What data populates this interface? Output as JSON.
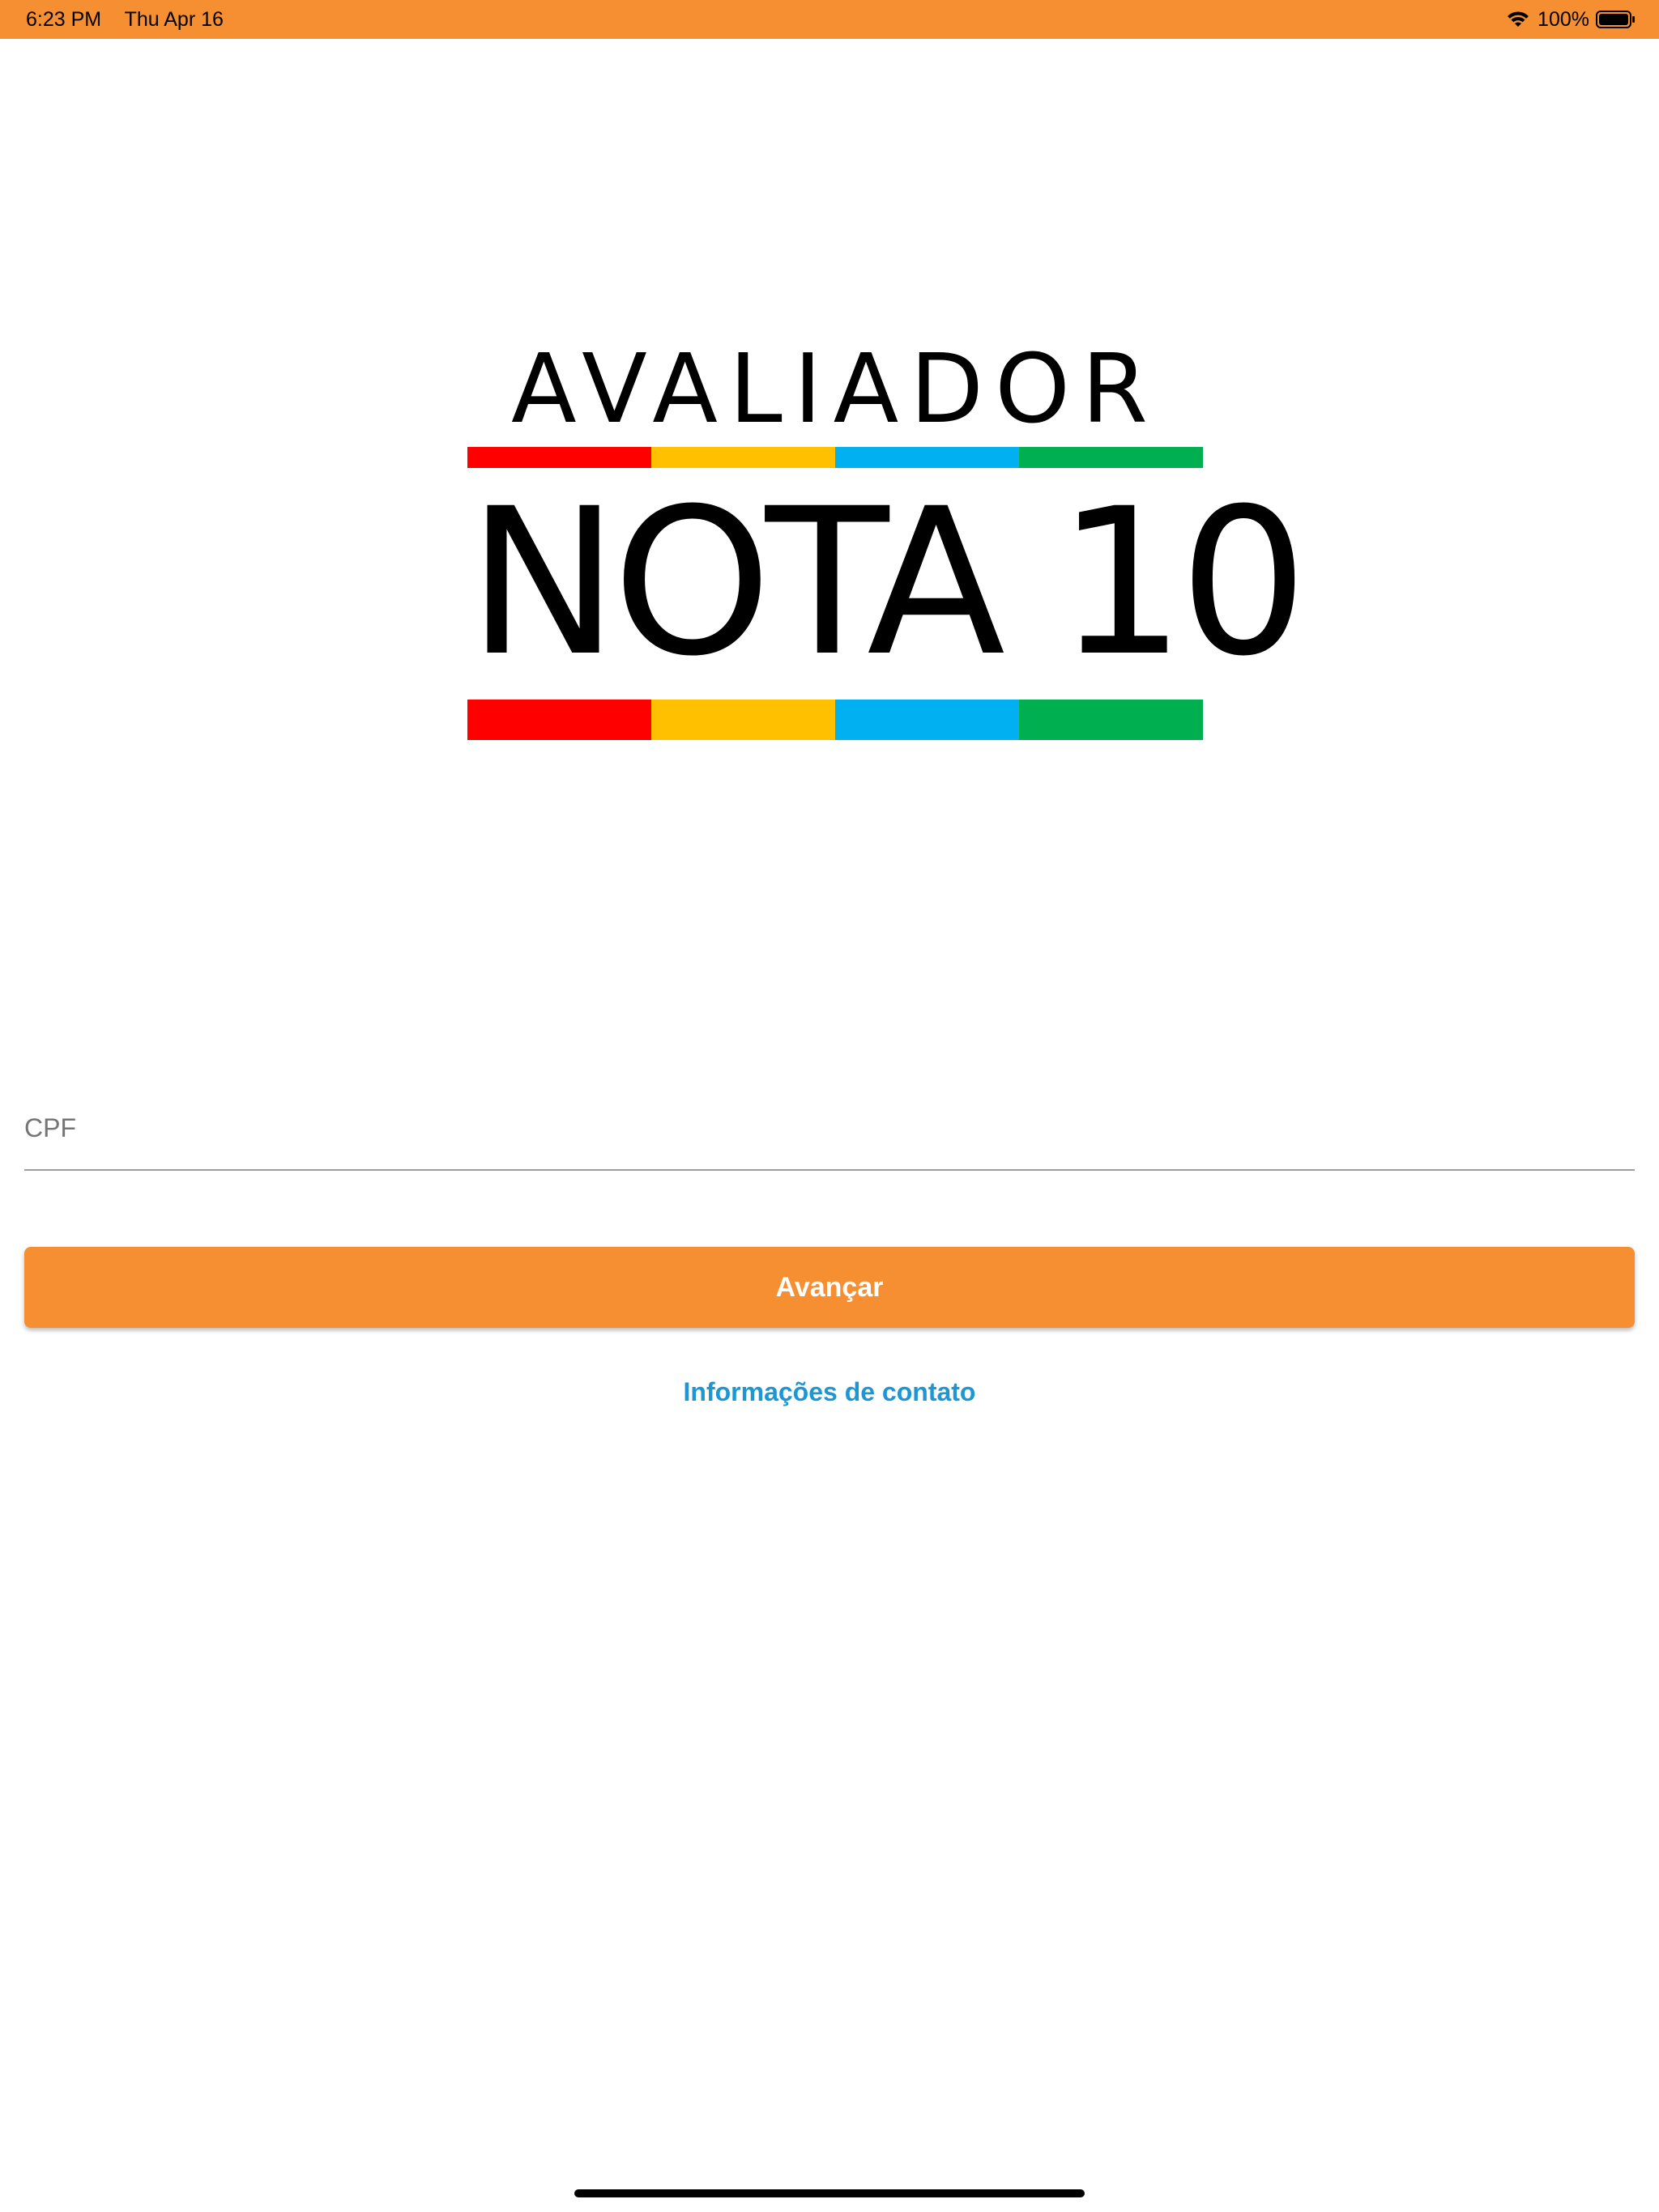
{
  "status_bar": {
    "time": "6:23 PM",
    "date": "Thu Apr 16",
    "battery_percent": "100%",
    "battery_level": 1.0,
    "background_color": "#F58F32",
    "icons": [
      "wifi-icon",
      "battery-icon"
    ]
  },
  "logo": {
    "top_text": "AVALIADOR",
    "main_text": "NOTA 10",
    "bar_colors": [
      "#FF0000",
      "#FFC000",
      "#00B0F0",
      "#00B050"
    ]
  },
  "form": {
    "cpf_placeholder": "CPF",
    "cpf_value": "",
    "advance_label": "Avançar",
    "contact_link": "Informações de contato"
  },
  "colors": {
    "accent": "#F58F32",
    "link": "#1E96D4"
  }
}
